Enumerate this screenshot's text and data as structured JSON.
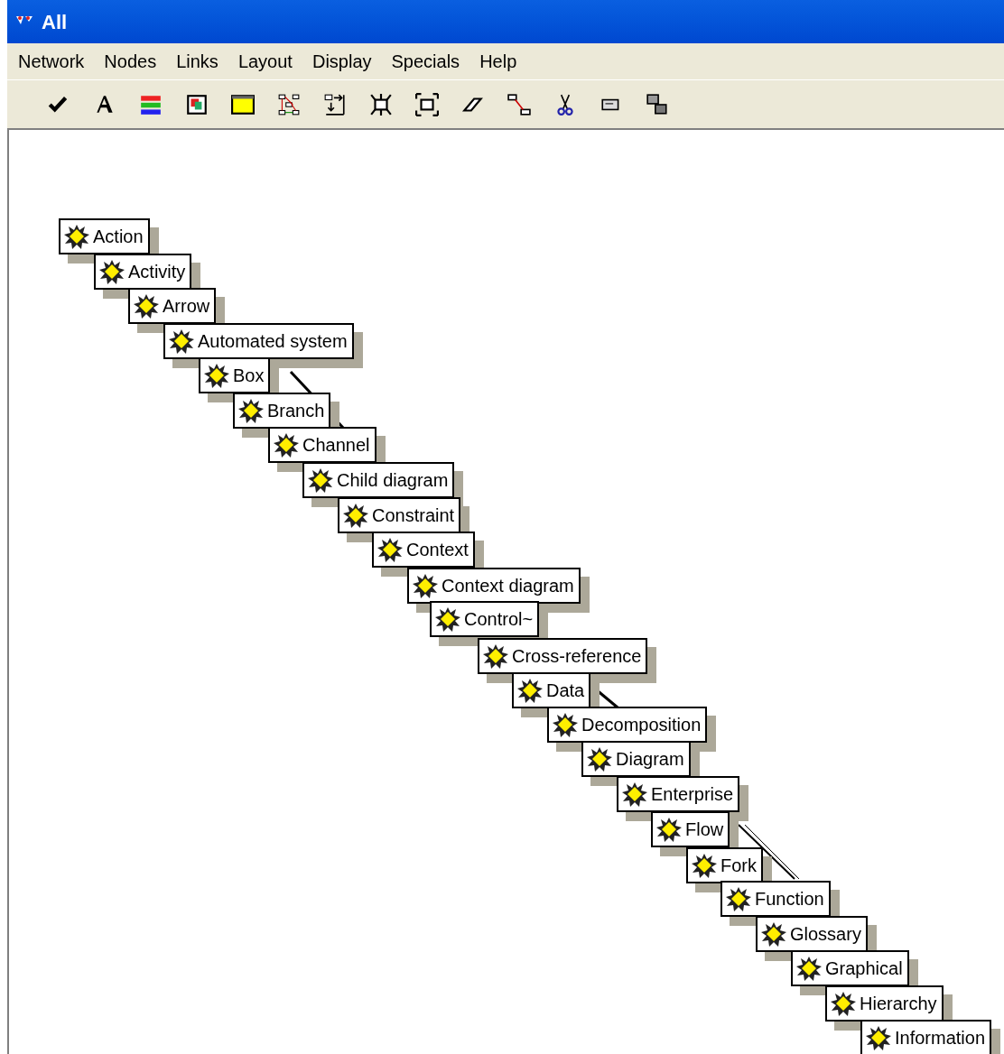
{
  "window": {
    "title": "All"
  },
  "menu": [
    "Network",
    "Nodes",
    "Links",
    "Layout",
    "Display",
    "Specials",
    "Help"
  ],
  "toolbar": [
    {
      "kind": "check"
    },
    {
      "kind": "font"
    },
    {
      "kind": "colors"
    },
    {
      "kind": "picture"
    },
    {
      "kind": "window"
    },
    {
      "kind": "network"
    },
    {
      "kind": "import"
    },
    {
      "kind": "shrink"
    },
    {
      "kind": "expand"
    },
    {
      "kind": "eraser"
    },
    {
      "kind": "link"
    },
    {
      "kind": "cut"
    },
    {
      "kind": "label"
    },
    {
      "kind": "overlap"
    }
  ],
  "nodes": [
    "Action",
    "Activity",
    "Arrow",
    "Automated system",
    "Box",
    "Branch",
    "Channel",
    "Child diagram",
    "Constraint",
    "Context",
    "Context diagram",
    "Control~",
    "Cross-reference",
    "Data",
    "Decomposition",
    "Diagram",
    "Enterprise",
    "Flow",
    "Fork",
    "Function",
    "Glossary",
    "Graphical",
    "Hierarchy",
    "Information"
  ]
}
